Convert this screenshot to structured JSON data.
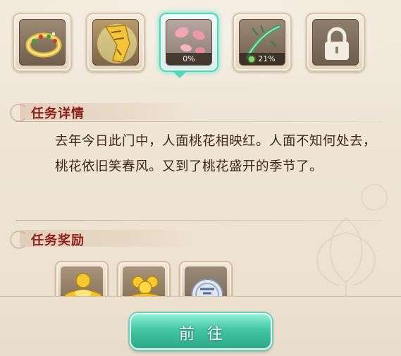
{
  "items": [
    {
      "icon": "ring-icon",
      "progress": null
    },
    {
      "icon": "gold-scroll-icon",
      "progress": null
    },
    {
      "icon": "peach-petals-icon",
      "progress": "0%",
      "active": true
    },
    {
      "icon": "jade-flute-icon",
      "progress": "21%"
    },
    {
      "icon": "lock-icon",
      "progress": null
    }
  ],
  "detail": {
    "title": "任务详情",
    "text": "去年今日此门中，人面桃花相映红。人面不知何处去，桃花依旧笑春风。又到了桃花盛开的季节了。"
  },
  "rewards": {
    "title": "任务奖励",
    "items": [
      {
        "icon": "gold-ingot-icon"
      },
      {
        "icon": "gold-coins-icon"
      },
      {
        "icon": "silver-coin-icon"
      }
    ]
  },
  "action": {
    "go_label": "前往"
  },
  "colors": {
    "accent": "#43c7a2",
    "title": "#8c1f1c",
    "text": "#3a2a1e"
  }
}
